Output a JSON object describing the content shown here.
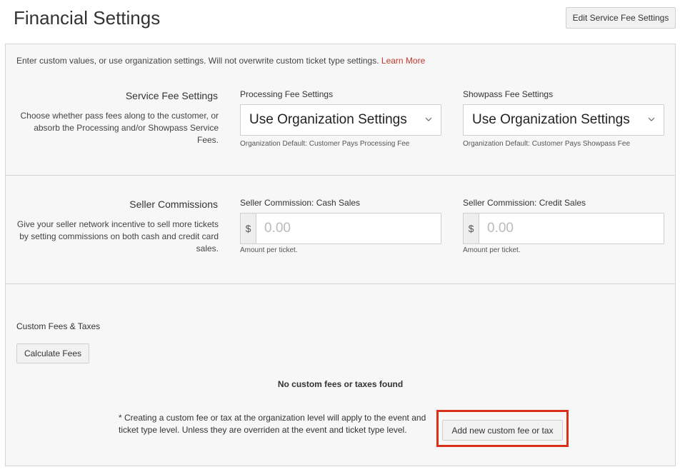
{
  "header": {
    "title": "Financial Settings",
    "edit_button": "Edit Service Fee Settings"
  },
  "intro": {
    "text": "Enter custom values, or use organization settings. Will not overwrite custom ticket type settings.",
    "learn_more": "Learn More"
  },
  "service_fee": {
    "title": "Service Fee Settings",
    "description": "Choose whether pass fees along to the customer, or absorb the Processing and/or Showpass Service Fees.",
    "processing": {
      "label": "Processing Fee Settings",
      "value": "Use Organization Settings",
      "hint": "Organization Default: Customer Pays Processing Fee"
    },
    "showpass": {
      "label": "Showpass Fee Settings",
      "value": "Use Organization Settings",
      "hint": "Organization Default: Customer Pays Showpass Fee"
    }
  },
  "seller_commissions": {
    "title": "Seller Commissions",
    "description": "Give your seller network incentive to sell more tickets by setting commissions on both cash and credit card sales.",
    "cash": {
      "label": "Seller Commission: Cash Sales",
      "addon": "$",
      "placeholder": "0.00",
      "hint": "Amount per ticket."
    },
    "credit": {
      "label": "Seller Commission: Credit Sales",
      "addon": "$",
      "placeholder": "0.00",
      "hint": "Amount per ticket."
    }
  },
  "custom_fees": {
    "title": "Custom Fees & Taxes",
    "calculate_button": "Calculate Fees",
    "empty_message": "No custom fees or taxes found",
    "footnote": "* Creating a custom fee or tax at the organization level will apply to the event and ticket type level. Unless they are overriden at the event and ticket type level.",
    "add_button": "Add new custom fee or tax"
  },
  "colors": {
    "accent_link": "#c0392b",
    "highlight": "#d8311a",
    "panel_bg": "#f7f7f7"
  },
  "icons": {
    "select_chevron": "chevron-down-icon"
  }
}
